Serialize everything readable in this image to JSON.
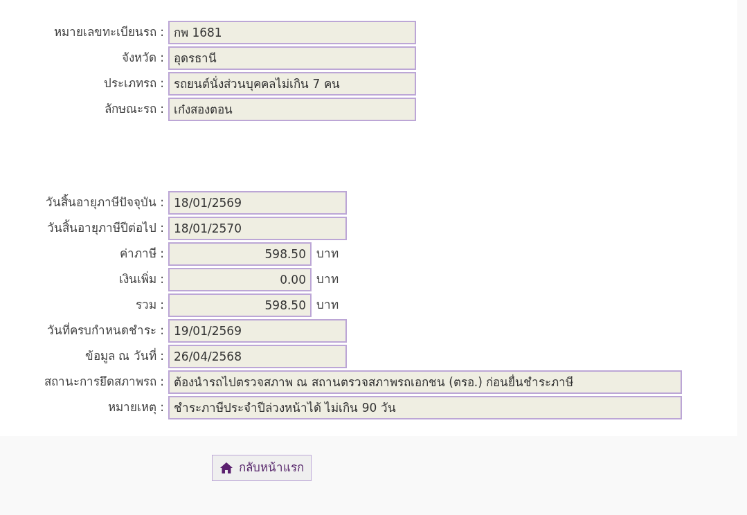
{
  "sections": [
    {
      "fields": [
        {
          "label": "หมายเลขทะเบียนรถ :",
          "value": "กพ 1681",
          "kind": "text"
        },
        {
          "label": "จังหวัด :",
          "value": "อุดรธานี",
          "kind": "text"
        },
        {
          "label": "ประเภทรถ :",
          "value": "รถยนต์นั่งส่วนบุคคลไม่เกิน 7 คน",
          "kind": "text"
        },
        {
          "label": "ลักษณะรถ :",
          "value": "เก๋งสองตอน",
          "kind": "text"
        }
      ]
    },
    {
      "fields": [
        {
          "label": "วันสิ้นอายุภาษีปัจจุบัน :",
          "value": "18/01/2569",
          "kind": "date"
        },
        {
          "label": "วันสิ้นอายุภาษีปีต่อไป :",
          "value": "18/01/2570",
          "kind": "date"
        },
        {
          "label": "ค่าภาษี :",
          "value": "598.50",
          "kind": "money",
          "unit": "บาท"
        },
        {
          "label": "เงินเพิ่ม :",
          "value": "0.00",
          "kind": "money",
          "unit": "บาท"
        },
        {
          "label": "รวม :",
          "value": "598.50",
          "kind": "money",
          "unit": "บาท"
        },
        {
          "label": "วันที่ครบกำหนดชำระ :",
          "value": "19/01/2569",
          "kind": "date"
        },
        {
          "label": "ข้อมูล ณ วันที่ :",
          "value": "26/04/2568",
          "kind": "date"
        },
        {
          "label": "สถานะการยึดสภาพรถ :",
          "value": "ต้องนำรถไปตรวจสภาพ ณ สถานตรวจสภาพรถเอกชน (ตรอ.) ก่อนยื่นชำระภาษี",
          "kind": "note"
        },
        {
          "label": "หมายเหตุ :",
          "value": "ชำระภาษีประจำปีล่วงหน้าได้ ไม่เกิน 90 วัน",
          "kind": "note"
        }
      ]
    }
  ],
  "home_button": {
    "label": "กลับหน้าแรก"
  }
}
